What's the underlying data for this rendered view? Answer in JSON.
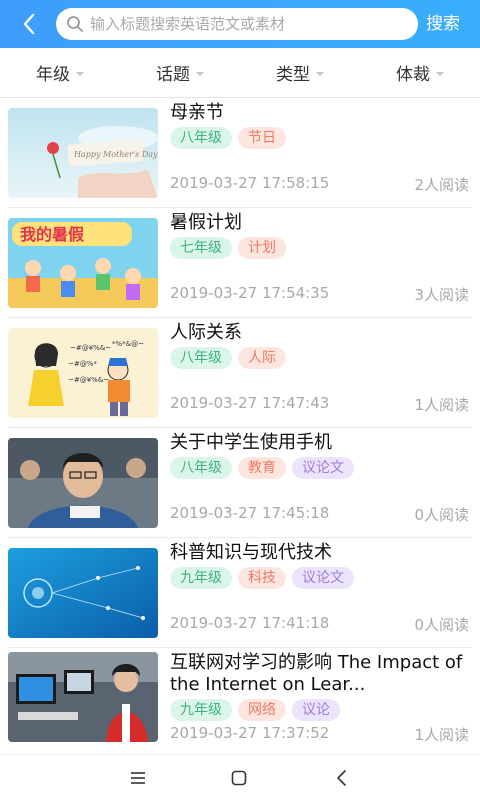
{
  "header": {
    "search_placeholder": "输入标题搜索英语范文或素材",
    "search_button": "搜索"
  },
  "filters": [
    "年级",
    "话题",
    "类型",
    "体裁"
  ],
  "articles": [
    {
      "title": "母亲节",
      "tags": [
        {
          "text": "八年级",
          "kind": "grade"
        },
        {
          "text": "节日",
          "kind": "topic"
        }
      ],
      "date": "2019-03-27 17:58:15",
      "reads": "2人阅读",
      "thumb": "mothers-day"
    },
    {
      "title": "暑假计划",
      "tags": [
        {
          "text": "七年级",
          "kind": "grade"
        },
        {
          "text": "计划",
          "kind": "topic"
        }
      ],
      "date": "2019-03-27 17:54:35",
      "reads": "3人阅读",
      "thumb": "summer-vacation"
    },
    {
      "title": "人际关系",
      "tags": [
        {
          "text": "八年级",
          "kind": "grade"
        },
        {
          "text": "人际",
          "kind": "topic"
        }
      ],
      "date": "2019-03-27 17:47:43",
      "reads": "1人阅读",
      "thumb": "relationship"
    },
    {
      "title": "关于中学生使用手机",
      "tags": [
        {
          "text": "八年级",
          "kind": "grade"
        },
        {
          "text": "教育",
          "kind": "topic"
        },
        {
          "text": "议论文",
          "kind": "genre"
        }
      ],
      "date": "2019-03-27 17:45:18",
      "reads": "0人阅读",
      "thumb": "students-phone"
    },
    {
      "title": "科普知识与现代技术",
      "tags": [
        {
          "text": "九年级",
          "kind": "grade"
        },
        {
          "text": "科技",
          "kind": "topic"
        },
        {
          "text": "议论文",
          "kind": "genre"
        }
      ],
      "date": "2019-03-27 17:41:18",
      "reads": "0人阅读",
      "thumb": "technology"
    },
    {
      "title": "互联网对学习的影响 The Impact of the Internet on Lear...",
      "tags": [
        {
          "text": "九年级",
          "kind": "grade"
        },
        {
          "text": "网络",
          "kind": "topic"
        },
        {
          "text": "议论",
          "kind": "genre"
        }
      ],
      "date": "2019-03-27 17:37:52",
      "reads": "1人阅读",
      "thumb": "computer-class"
    }
  ],
  "thumb_text": {
    "mothers_day": "Happy Mother's Day",
    "summer": "我的暑假",
    "relation_a": "~#@¥%&~",
    "relation_b": "*%*&@~",
    "relation_c": "~#@%*",
    "relation_d": "~#@¥%&~"
  },
  "colors": {
    "header_start": "#3f9dfb",
    "header_end": "#3aaefc",
    "grade_tag": "#3db37c",
    "topic_tag": "#ef7a64",
    "genre_tag": "#a07be0"
  }
}
